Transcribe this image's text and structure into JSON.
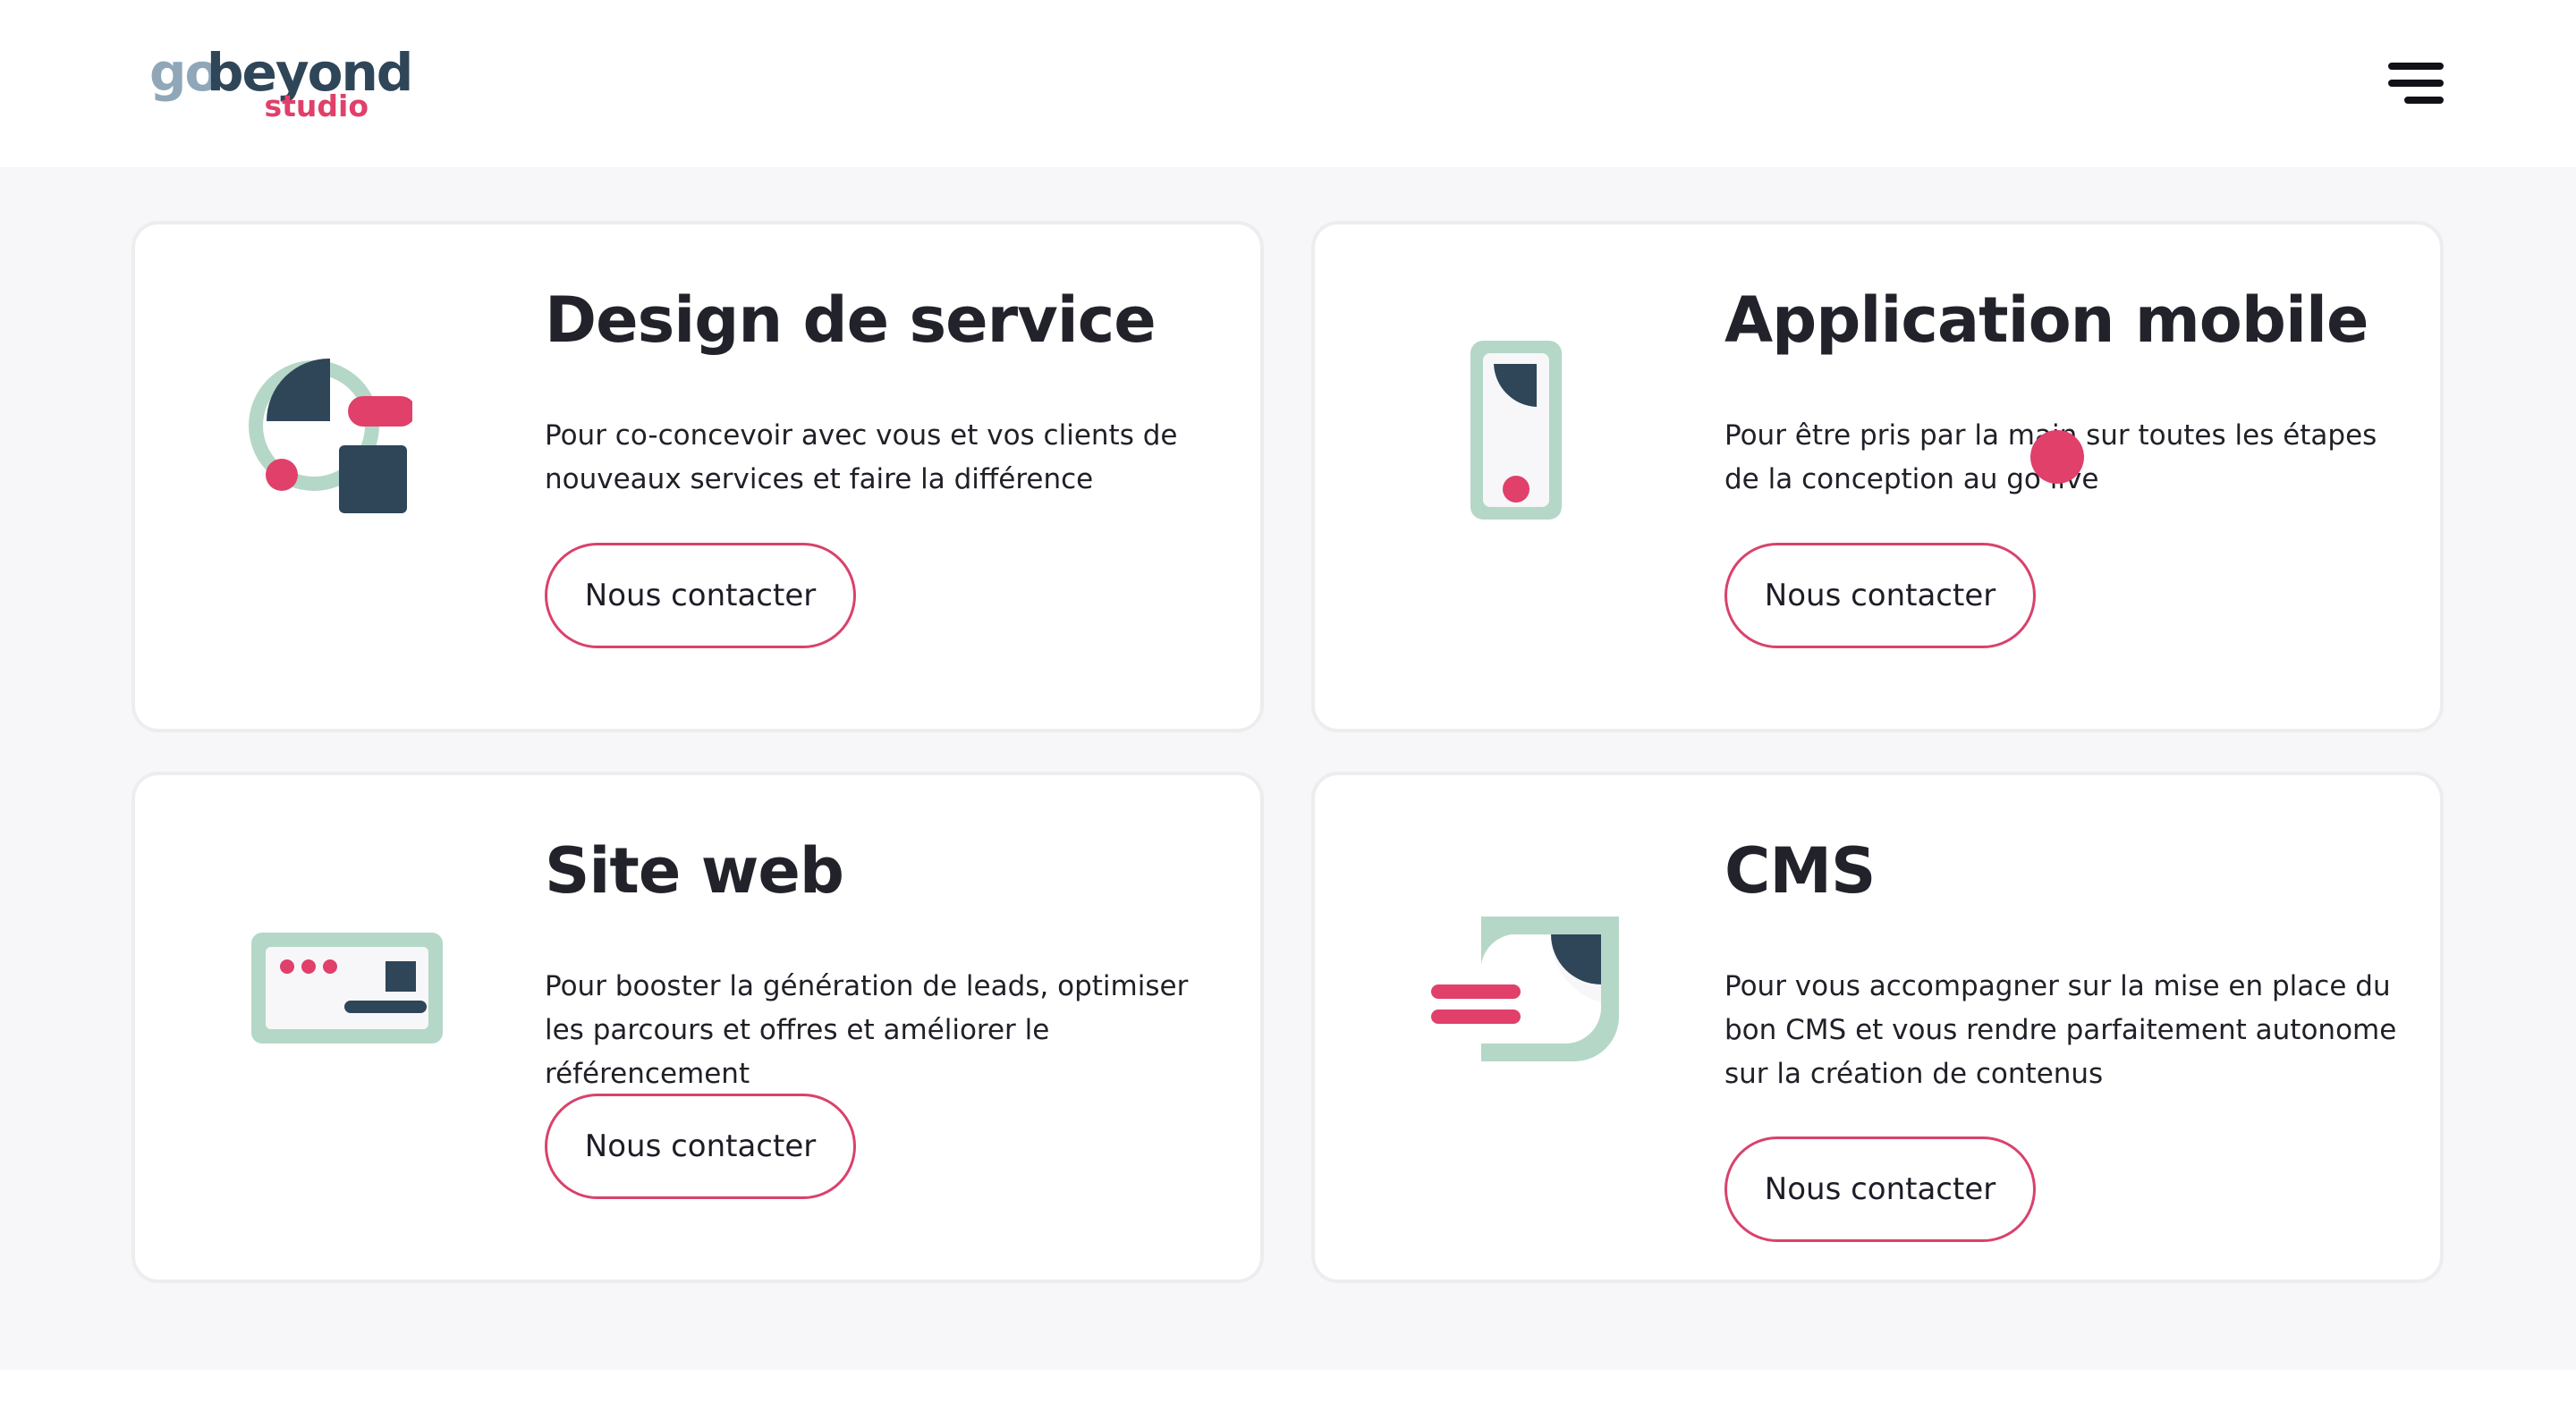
{
  "header": {
    "logo_go": "go",
    "logo_beyond": "beyond",
    "logo_studio": "studio"
  },
  "cards": [
    {
      "title": "Design de service",
      "description": "Pour co-concevoir avec vous et vos clients de nouveaux services et faire la différence",
      "button": "Nous contacter",
      "icon": "service-design-icon"
    },
    {
      "title": "Application mobile",
      "description": "Pour être pris par la main sur toutes les étapes de la conception au go live",
      "button": "Nous contacter",
      "icon": "mobile-app-icon"
    },
    {
      "title": "Site web",
      "description": "Pour booster la génération de leads, optimiser les parcours et offres et améliorer le référencement",
      "button": "Nous contacter",
      "icon": "website-icon"
    },
    {
      "title": "CMS",
      "description": "Pour vous accompagner sur la mise en place du bon CMS et vous rendre parfaitement autonome sur la création de contenus",
      "button": "Nous contacter",
      "icon": "cms-icon"
    }
  ],
  "colors": {
    "accent": "#e0406a",
    "navy": "#2f4558",
    "mint": "#b5d7c8",
    "text": "#1d1d27"
  }
}
